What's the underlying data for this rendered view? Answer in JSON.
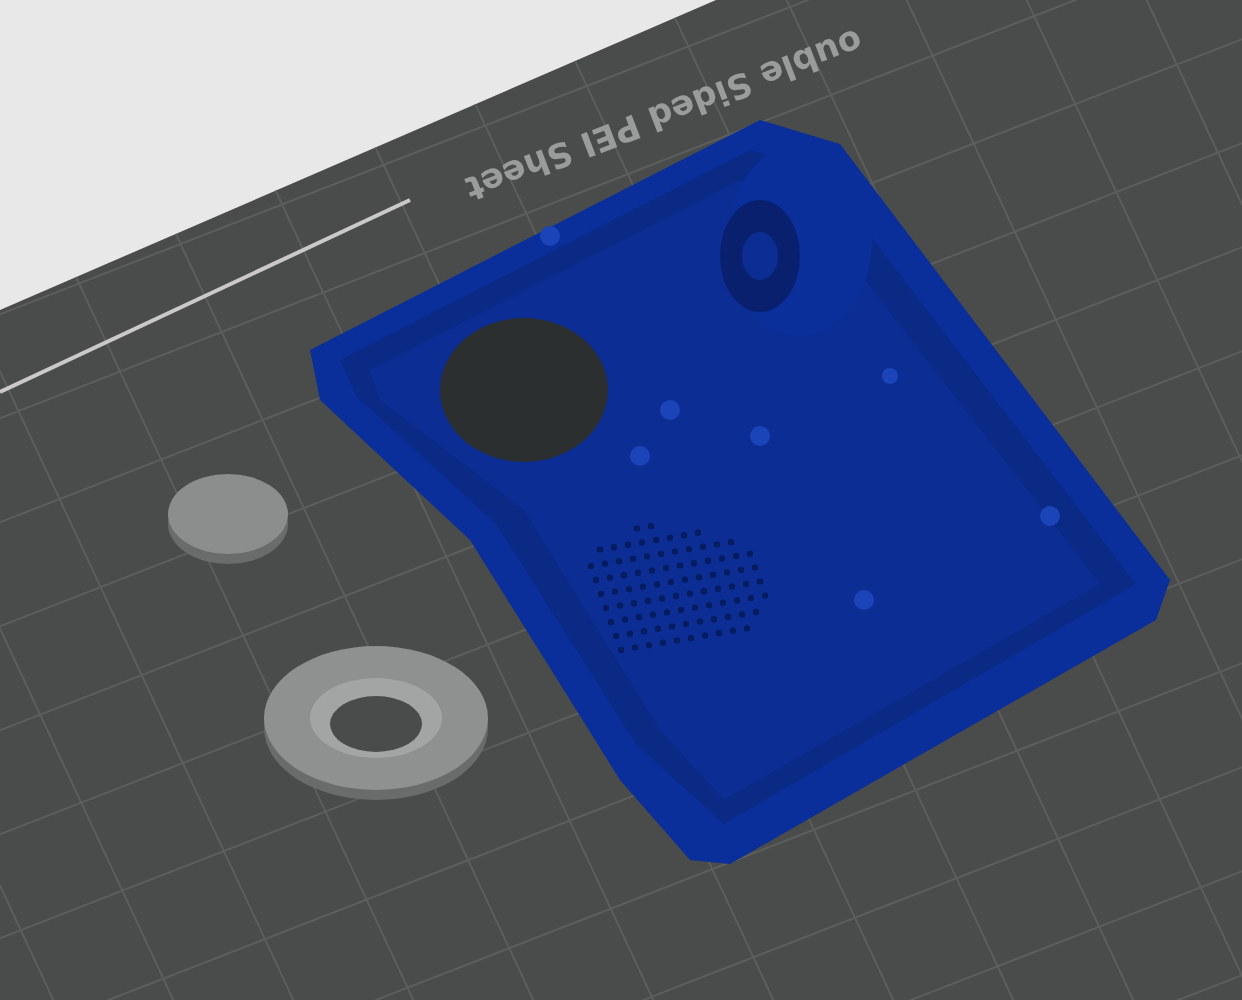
{
  "build_plate": {
    "label": "ouble Sided PEI Sheet"
  }
}
